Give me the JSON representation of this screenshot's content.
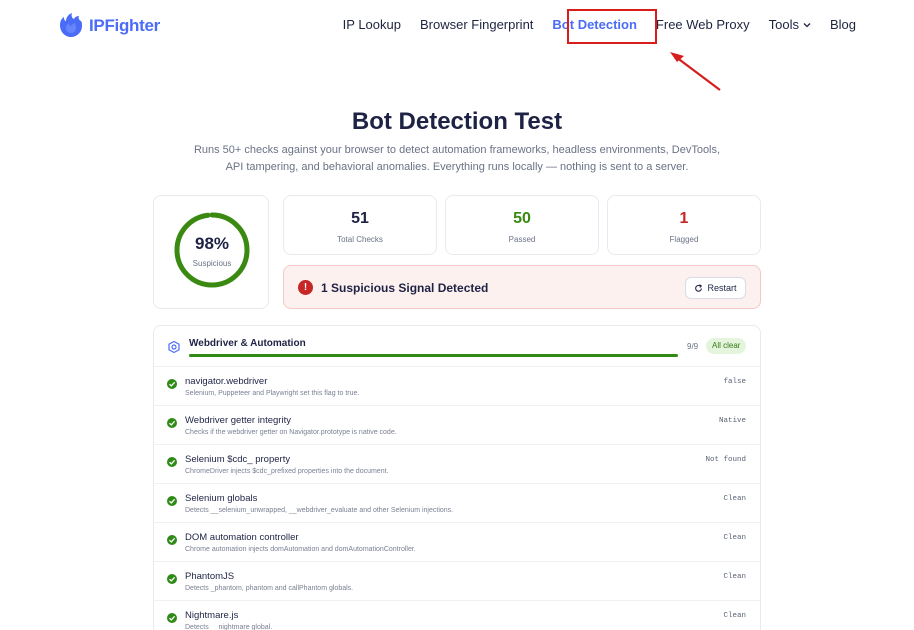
{
  "brand": {
    "name": "IPFighter",
    "color": "#4a6cf7"
  },
  "nav": {
    "items": [
      {
        "label": "IP Lookup",
        "active": false
      },
      {
        "label": "Browser Fingerprint",
        "active": false
      },
      {
        "label": "Bot Detection",
        "active": true
      },
      {
        "label": "Free Web Proxy",
        "active": false
      },
      {
        "label": "Tools",
        "active": false,
        "has_dropdown": true
      },
      {
        "label": "Blog",
        "active": false
      }
    ]
  },
  "hero": {
    "title": "Bot Detection Test",
    "subtitle": "Runs 50+ checks against your browser to detect automation frameworks, headless environments, DevTools, API tampering, and behavioral anomalies. Everything runs locally — nothing is sent to a server."
  },
  "score": {
    "value": "98%",
    "label": "Suspicious",
    "fraction": 0.98,
    "color": "#3a8a12"
  },
  "stats": [
    {
      "value": "51",
      "label": "Total Checks",
      "color": "#1e2345"
    },
    {
      "value": "50",
      "label": "Passed",
      "color": "#3a8a12"
    },
    {
      "value": "1",
      "label": "Flagged",
      "color": "#c62626"
    }
  ],
  "alert": {
    "icon": "!",
    "text": "1 Suspicious Signal Detected",
    "button_label": "Restart"
  },
  "section": {
    "title": "Webdriver & Automation",
    "count": "9/9",
    "badge": "All clear",
    "progress": 1.0,
    "checks": [
      {
        "name": "navigator.webdriver",
        "desc": "Selenium, Puppeteer and Playwright set this flag to true.",
        "value": "false"
      },
      {
        "name": "Webdriver getter integrity",
        "desc": "Checks if the webdriver getter on Navigator.prototype is native code.",
        "value": "Native"
      },
      {
        "name": "Selenium $cdc_ property",
        "desc": "ChromeDriver injects $cdc_prefixed properties into the document.",
        "value": "Not found"
      },
      {
        "name": "Selenium globals",
        "desc": "Detects __selenium_unwrapped, __webdriver_evaluate and other Selenium injections.",
        "value": "Clean"
      },
      {
        "name": "DOM automation controller",
        "desc": "Chrome automation injects domAutomation and domAutomationController.",
        "value": "Clean"
      },
      {
        "name": "PhantomJS",
        "desc": "Detects _phantom, phantom and callPhantom globals.",
        "value": "Clean"
      },
      {
        "name": "Nightmare.js",
        "desc": "Detects __nightmare global.",
        "value": "Clean"
      }
    ]
  }
}
